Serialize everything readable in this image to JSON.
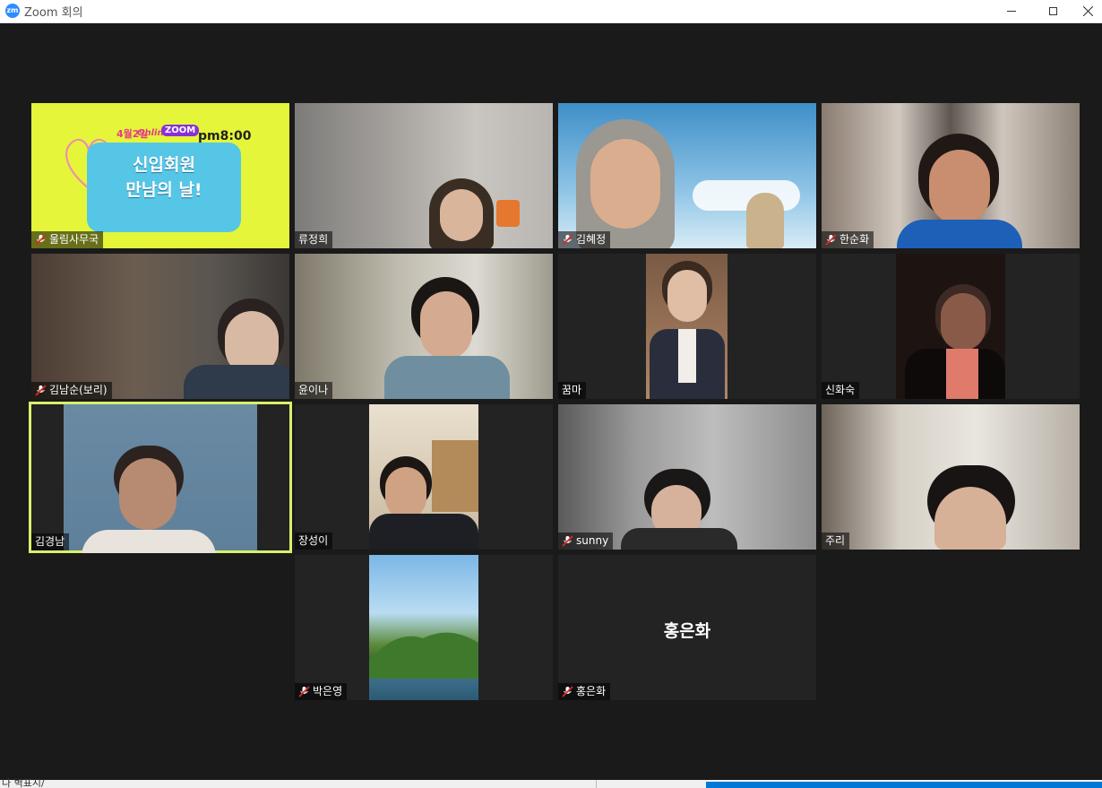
{
  "window": {
    "title": "Zoom 회의",
    "logo_text": "zm"
  },
  "participants": [
    {
      "name": "울림사무국",
      "muted": true
    },
    {
      "name": "류정희",
      "muted": false
    },
    {
      "name": "김혜정",
      "muted": true
    },
    {
      "name": "한순화",
      "muted": true
    },
    {
      "name": "김남순(보리)",
      "muted": true
    },
    {
      "name": "윤이나",
      "muted": false
    },
    {
      "name": "꿈마",
      "muted": false
    },
    {
      "name": "신화숙",
      "muted": false
    },
    {
      "name": "김경남",
      "muted": false,
      "active_speaker": true
    },
    {
      "name": "장성이",
      "muted": false
    },
    {
      "name": "sunny",
      "muted": true
    },
    {
      "name": "주리",
      "muted": false
    },
    {
      "name": "박은영",
      "muted": true
    },
    {
      "name": "홍은화",
      "muted": true,
      "video_off": true
    }
  ],
  "poster": {
    "date": "4월2일",
    "online": "Online",
    "zoom": "ZOOM",
    "time": "pm8:00",
    "title_line1": "신입회원",
    "title_line2": "만남의 날!"
  },
  "avatar_tile": {
    "display_name": "홍은화"
  },
  "taskbar": {
    "partial_text": "나 벽표시/"
  },
  "colors": {
    "active_speaker_border": "#d8f06a",
    "mute_red": "#e02828",
    "background": "#1a1a1a",
    "poster_bg": "#e4f53a"
  }
}
